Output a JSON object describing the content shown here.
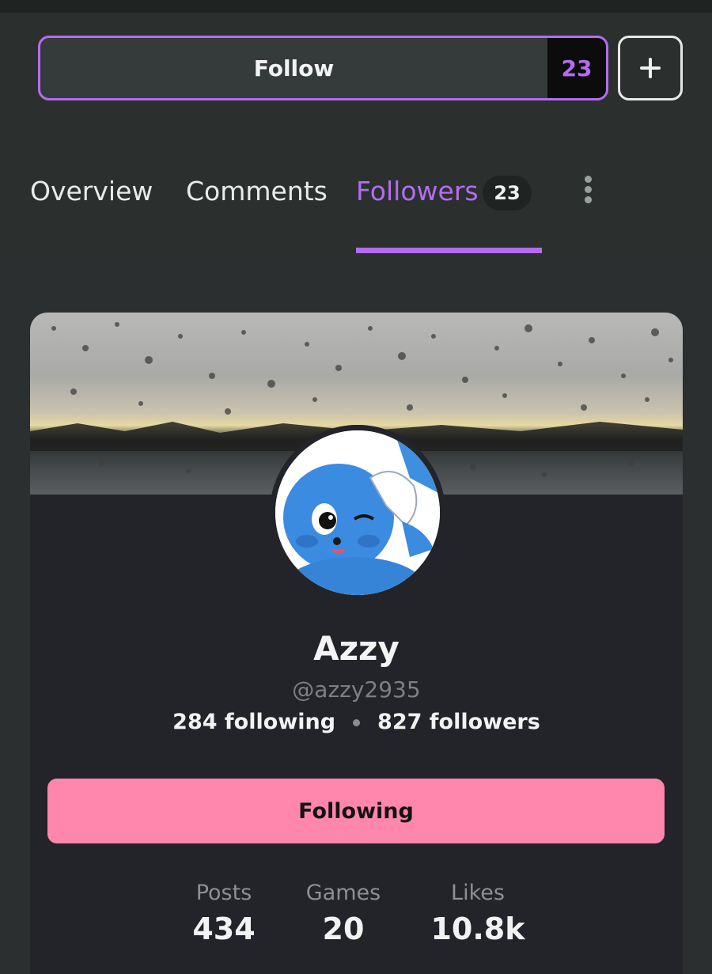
{
  "follow_bar": {
    "follow_label": "Follow",
    "follow_count": "23",
    "add_icon": "plus-icon"
  },
  "tabs": [
    {
      "label": "Overview"
    },
    {
      "label": "Comments"
    },
    {
      "label": "Followers",
      "badge": "23",
      "active": true
    }
  ],
  "more_icon": "more-vertical-icon",
  "profile": {
    "name": "Azzy",
    "handle": "@azzy2935",
    "following": "284 following",
    "followers": "827 followers",
    "action_label": "Following",
    "metrics": [
      {
        "label": "Posts",
        "value": "434"
      },
      {
        "label": "Games",
        "value": "20"
      },
      {
        "label": "Likes",
        "value": "10.8k"
      }
    ]
  },
  "colors": {
    "accent": "#b46cf0",
    "following_button": "#ff86ad",
    "background": "#2b302f",
    "card": "#232429"
  }
}
